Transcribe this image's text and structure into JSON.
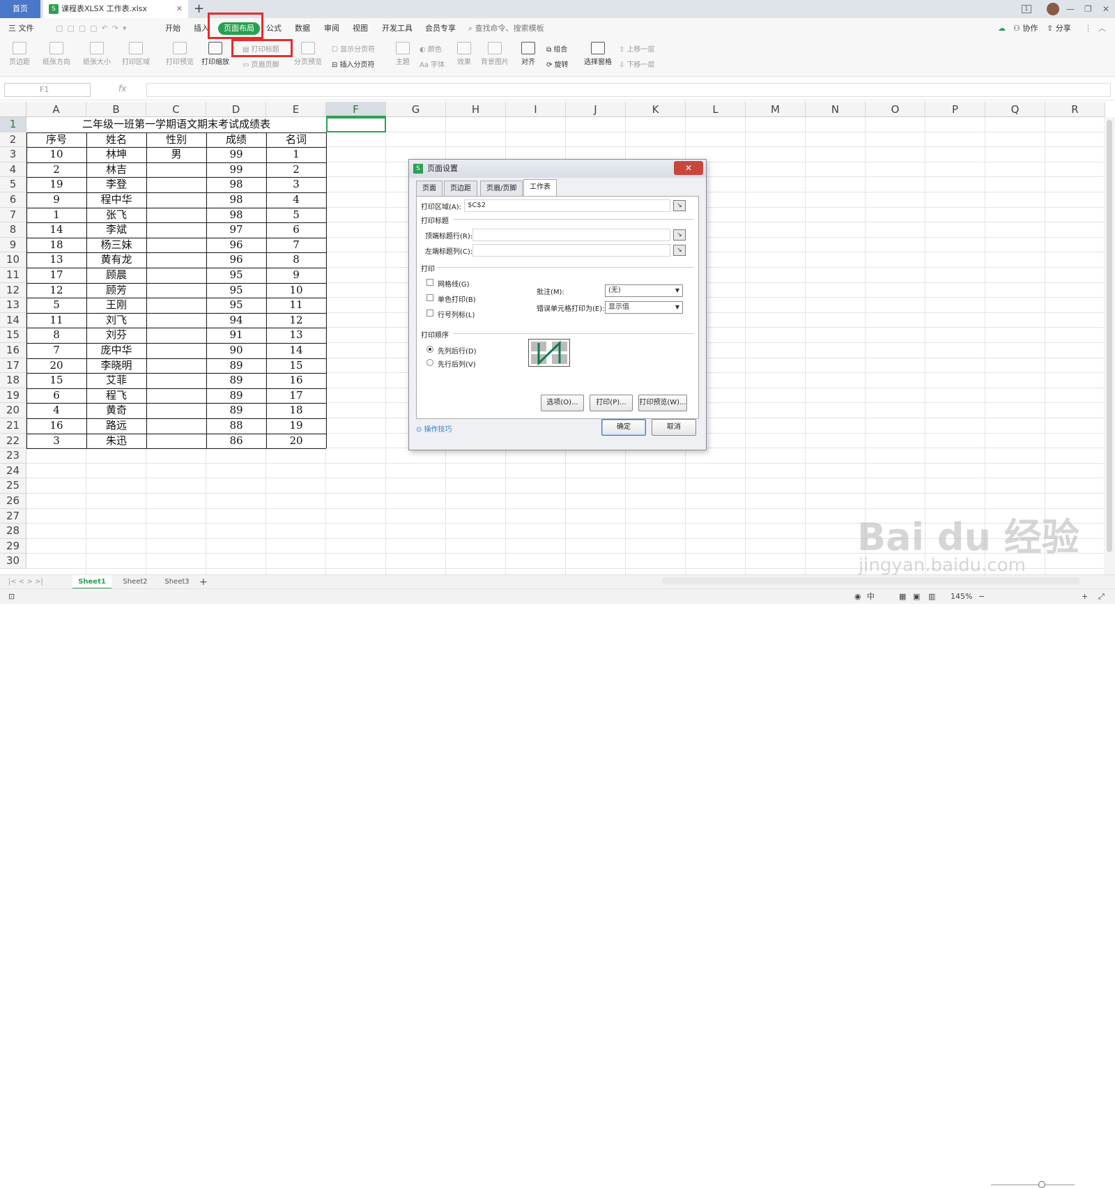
{
  "titlebar": {
    "home_tab": "首页",
    "file_tab": "课程表XLSX 工作表.xlsx",
    "file_icon": "S",
    "page_count": "1"
  },
  "menubar": {
    "file": "三 文件",
    "items": [
      "开始",
      "插入",
      "页面布局",
      "公式",
      "数据",
      "审阅",
      "视图",
      "开发工具",
      "会员专享"
    ],
    "search": "查找命令、搜索模板",
    "collab": "协作",
    "share": "分享"
  },
  "ribbon": {
    "margins": "页边距",
    "orientation": "纸张方向",
    "size": "纸张大小",
    "print_area": "打印区域",
    "print_preview": "打印预览",
    "print_scale": "打印缩放",
    "print_titles": "打印标题",
    "header_footer": "页眉页脚",
    "show_breaks": "显示分页符",
    "page_break_preview": "分页预览",
    "insert_break": "插入分页符",
    "theme": "主题",
    "colors": "颜色",
    "fonts": "Aa 字体",
    "effects": "效果",
    "background": "背景图片",
    "align": "对齐",
    "group": "组合",
    "rotate": "旋转",
    "selection_pane": "选择窗格",
    "bring_forward": "上移一层",
    "send_backward": "下移一层"
  },
  "formula": {
    "name_box": "F1",
    "fx": "fx"
  },
  "columns": [
    "A",
    "B",
    "C",
    "D",
    "E",
    "F",
    "G",
    "H",
    "I",
    "J",
    "K",
    "L",
    "M",
    "N",
    "O",
    "P",
    "Q",
    "R"
  ],
  "rows": [
    "1",
    "2",
    "3",
    "4",
    "5",
    "6",
    "7",
    "8",
    "9",
    "10",
    "11",
    "12",
    "13",
    "14",
    "15",
    "16",
    "17",
    "18",
    "19",
    "20",
    "21",
    "22",
    "23",
    "24",
    "25",
    "26",
    "27",
    "28",
    "29",
    "30"
  ],
  "table": {
    "title": "二年级一班第一学期语文期末考试成绩表",
    "headers": [
      "序号",
      "姓名",
      "性别",
      "成绩",
      "名词"
    ],
    "rows": [
      [
        "10",
        "林坤",
        "男",
        "99",
        "1"
      ],
      [
        "2",
        "林吉",
        "",
        "99",
        "2"
      ],
      [
        "19",
        "李登",
        "",
        "98",
        "3"
      ],
      [
        "9",
        "程中华",
        "",
        "98",
        "4"
      ],
      [
        "1",
        "张飞",
        "",
        "98",
        "5"
      ],
      [
        "14",
        "李斌",
        "",
        "97",
        "6"
      ],
      [
        "18",
        "杨三妹",
        "",
        "96",
        "7"
      ],
      [
        "13",
        "黄有龙",
        "",
        "96",
        "8"
      ],
      [
        "17",
        "顾晨",
        "",
        "95",
        "9"
      ],
      [
        "12",
        "顾芳",
        "",
        "95",
        "10"
      ],
      [
        "5",
        "王刚",
        "",
        "95",
        "11"
      ],
      [
        "11",
        "刘飞",
        "",
        "94",
        "12"
      ],
      [
        "8",
        "刘芬",
        "",
        "91",
        "13"
      ],
      [
        "7",
        "庞中华",
        "",
        "90",
        "14"
      ],
      [
        "20",
        "李晓明",
        "",
        "89",
        "15"
      ],
      [
        "15",
        "艾菲",
        "",
        "89",
        "16"
      ],
      [
        "6",
        "程飞",
        "",
        "89",
        "17"
      ],
      [
        "4",
        "黄奇",
        "",
        "89",
        "18"
      ],
      [
        "16",
        "路远",
        "",
        "88",
        "19"
      ],
      [
        "3",
        "朱迅",
        "",
        "86",
        "20"
      ]
    ]
  },
  "dialog": {
    "title": "页面设置",
    "tabs": [
      "页面",
      "页边距",
      "页眉/页脚",
      "工作表"
    ],
    "print_area_label": "打印区域(A):",
    "print_area_value": "$C$2",
    "print_titles_section": "打印标题",
    "top_rows_label": "顶端标题行(R):",
    "left_cols_label": "左端标题列(C):",
    "print_section": "打印",
    "gridlines": "网格线(G)",
    "mono": "单色打印(B)",
    "row_col_headers": "行号列标(L)",
    "comments_label": "批注(M):",
    "comments_value": "(无)",
    "errors_label": "错误单元格打印为(E):",
    "errors_value": "显示值",
    "order_section": "打印顺序",
    "down_then_over": "先列后行(D)",
    "over_then_down": "先行后列(V)",
    "options_btn": "选项(O)...",
    "print_btn": "打印(P)...",
    "preview_btn": "打印预览(W)...",
    "tips_link": "操作技巧",
    "ok_btn": "确定",
    "cancel_btn": "取消"
  },
  "sheets": [
    "Sheet1",
    "Sheet2",
    "Sheet3"
  ],
  "status": {
    "zoom": "145%",
    "ime": "中"
  },
  "watermark": {
    "brand": "Bai du 经验",
    "url": "jingyan.baidu.com"
  },
  "colors": {
    "accent_green": "#2aa151",
    "highlight_red": "#e62b2b",
    "home_blue": "#4a78c8"
  }
}
